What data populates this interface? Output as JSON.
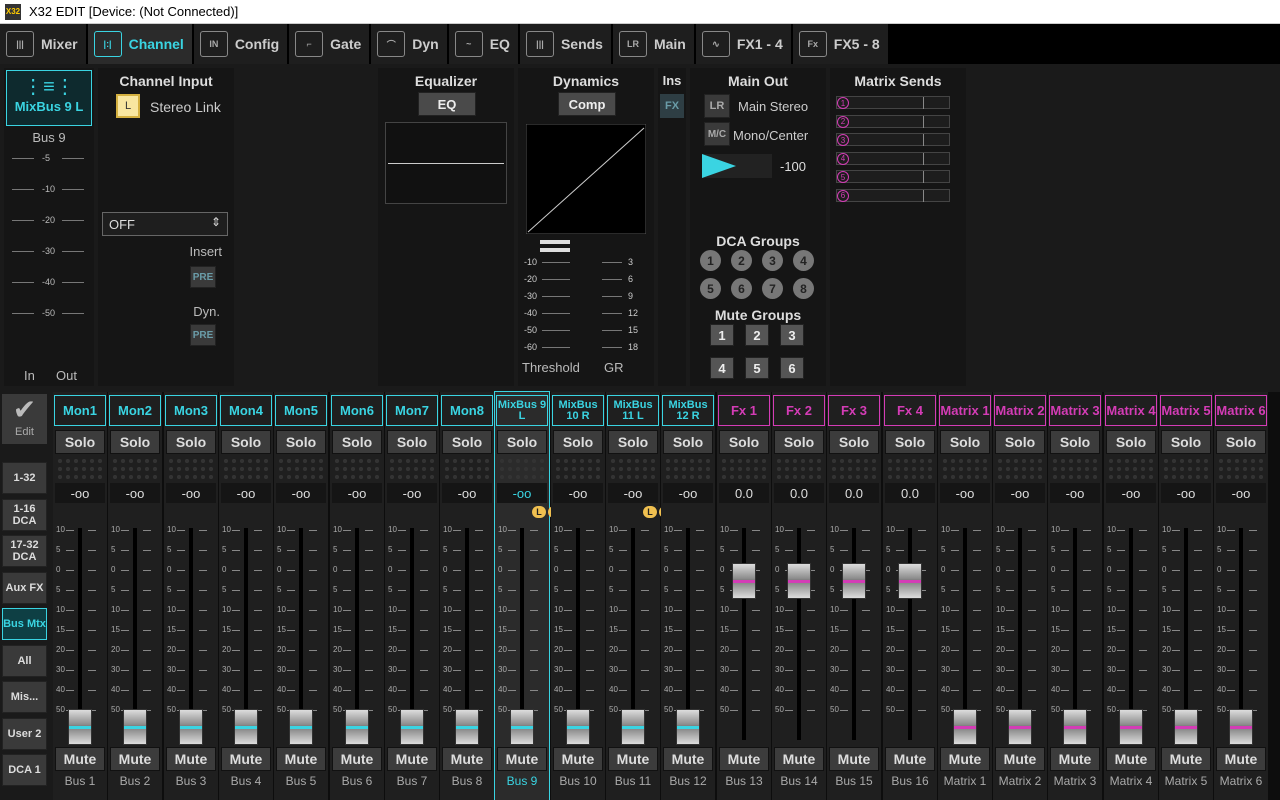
{
  "window": {
    "title": "X32 EDIT [Device: (Not Connected)]",
    "icon_text": "X32"
  },
  "tabs": [
    {
      "label": "Mixer",
      "icon": "mixer-icon",
      "glyph": "|||"
    },
    {
      "label": "Channel",
      "icon": "channel-icon",
      "glyph": "|:|",
      "active": true
    },
    {
      "label": "Config",
      "icon": "config-icon",
      "glyph": "IN"
    },
    {
      "label": "Gate",
      "icon": "gate-icon",
      "glyph": "⌐"
    },
    {
      "label": "Dyn",
      "icon": "dyn-icon",
      "glyph": "⌒"
    },
    {
      "label": "EQ",
      "icon": "eq-icon",
      "glyph": "~"
    },
    {
      "label": "Sends",
      "icon": "sends-icon",
      "glyph": "|||"
    },
    {
      "label": "Main",
      "icon": "main-icon",
      "glyph": "LR"
    },
    {
      "label": "FX1 - 4",
      "icon": "fx-wave-icon",
      "glyph": "∿"
    },
    {
      "label": "FX5 - 8",
      "icon": "fx-box-icon",
      "glyph": "Fx"
    }
  ],
  "channel": {
    "name": "MixBus 9 L",
    "sub": "Bus 9",
    "scale": [
      "-5",
      "-10",
      "-20",
      "-30",
      "-40",
      "-50"
    ],
    "in": "In",
    "out": "Out"
  },
  "input": {
    "title": "Channel Input",
    "stereo_l": "L",
    "stereo_link": "Stereo Link",
    "select": "OFF",
    "insert": "Insert",
    "pre1": "PRE",
    "dyn": "Dyn.",
    "pre2": "PRE"
  },
  "equalizer": {
    "title": "Equalizer",
    "button": "EQ"
  },
  "dynamics": {
    "title": "Dynamics",
    "button": "Comp",
    "threshold": "Threshold",
    "gr": "GR",
    "tscale": [
      "-10",
      "-20",
      "-30",
      "-40",
      "-50",
      "-60"
    ],
    "grscale": [
      "3",
      "6",
      "9",
      "12",
      "15",
      "18"
    ]
  },
  "ins": {
    "title": "Ins",
    "fx": "FX"
  },
  "main_out": {
    "title": "Main Out",
    "lr": "LR",
    "lr_label": "Main Stereo",
    "mc": "M/C",
    "mc_label": "Mono/Center",
    "pan_value": "-100"
  },
  "dca": {
    "title": "DCA Groups",
    "items": [
      "1",
      "2",
      "3",
      "4",
      "5",
      "6",
      "7",
      "8"
    ]
  },
  "mute_groups": {
    "title": "Mute Groups",
    "items": [
      "1",
      "2",
      "3",
      "4",
      "5",
      "6"
    ]
  },
  "matrix_sends": {
    "title": "Matrix Sends",
    "items": [
      "1",
      "2",
      "3",
      "4",
      "5",
      "6"
    ]
  },
  "left_nav": {
    "edit": "Edit",
    "items": [
      "1-32",
      "1-16 DCA",
      "17-32 DCA",
      "Aux FX",
      "Bus Mtx",
      "All",
      "Mis...",
      "User 2",
      "DCA 1"
    ],
    "active": "Bus Mtx"
  },
  "strips": [
    {
      "name": "Mon1",
      "bus": "Bus 1",
      "level": "-oo",
      "fader": 0.06,
      "type": "bus"
    },
    {
      "name": "Mon2",
      "bus": "Bus 2",
      "level": "-oo",
      "fader": 0.06,
      "type": "bus"
    },
    {
      "name": "Mon3",
      "bus": "Bus 3",
      "level": "-oo",
      "fader": 0.06,
      "type": "bus"
    },
    {
      "name": "Mon4",
      "bus": "Bus 4",
      "level": "-oo",
      "fader": 0.06,
      "type": "bus"
    },
    {
      "name": "Mon5",
      "bus": "Bus 5",
      "level": "-oo",
      "fader": 0.06,
      "type": "bus"
    },
    {
      "name": "Mon6",
      "bus": "Bus 6",
      "level": "-oo",
      "fader": 0.06,
      "type": "bus"
    },
    {
      "name": "Mon7",
      "bus": "Bus 7",
      "level": "-oo",
      "fader": 0.06,
      "type": "bus"
    },
    {
      "name": "Mon8",
      "bus": "Bus 8",
      "level": "-oo",
      "fader": 0.06,
      "type": "bus"
    },
    {
      "name": "MixBus 9 L",
      "bus": "Bus 9",
      "level": "-oo",
      "fader": 0.06,
      "type": "bus",
      "selected": true,
      "lr": true
    },
    {
      "name": "MixBus 10 R",
      "bus": "Bus 10",
      "level": "-oo",
      "fader": 0.06,
      "type": "bus"
    },
    {
      "name": "MixBus 11 L",
      "bus": "Bus 11",
      "level": "-oo",
      "fader": 0.06,
      "type": "bus",
      "lr": true
    },
    {
      "name": "MixBus 12 R",
      "bus": "Bus 12",
      "level": "-oo",
      "fader": 0.06,
      "type": "bus"
    },
    {
      "name": "Fx 1",
      "bus": "Bus 13",
      "level": "0.0",
      "fader": 0.75,
      "type": "fx"
    },
    {
      "name": "Fx 2",
      "bus": "Bus 14",
      "level": "0.0",
      "fader": 0.75,
      "type": "fx"
    },
    {
      "name": "Fx 3",
      "bus": "Bus 15",
      "level": "0.0",
      "fader": 0.75,
      "type": "fx"
    },
    {
      "name": "Fx 4",
      "bus": "Bus 16",
      "level": "0.0",
      "fader": 0.75,
      "type": "fx"
    },
    {
      "name": "Matrix 1",
      "bus": "Matrix 1",
      "level": "-oo",
      "fader": 0.06,
      "type": "fx"
    },
    {
      "name": "Matrix 2",
      "bus": "Matrix 2",
      "level": "-oo",
      "fader": 0.06,
      "type": "fx"
    },
    {
      "name": "Matrix 3",
      "bus": "Matrix 3",
      "level": "-oo",
      "fader": 0.06,
      "type": "fx"
    },
    {
      "name": "Matrix 4",
      "bus": "Matrix 4",
      "level": "-oo",
      "fader": 0.06,
      "type": "fx"
    },
    {
      "name": "Matrix 5",
      "bus": "Matrix 5",
      "level": "-oo",
      "fader": 0.06,
      "type": "fx"
    },
    {
      "name": "Matrix 6",
      "bus": "Matrix 6",
      "level": "-oo",
      "fader": 0.06,
      "type": "fx"
    }
  ],
  "strip_labels": {
    "solo": "Solo",
    "mute": "Mute",
    "l": "L",
    "r": "R",
    "scale": [
      "10",
      "5",
      "0",
      "5",
      "10",
      "15",
      "20",
      "30",
      "40",
      "50"
    ]
  },
  "colors": {
    "accent": "#3ad4e2",
    "fx": "#d43cb6",
    "bus_line": "#3ad4e2",
    "fx_line": "#d43cb6"
  }
}
